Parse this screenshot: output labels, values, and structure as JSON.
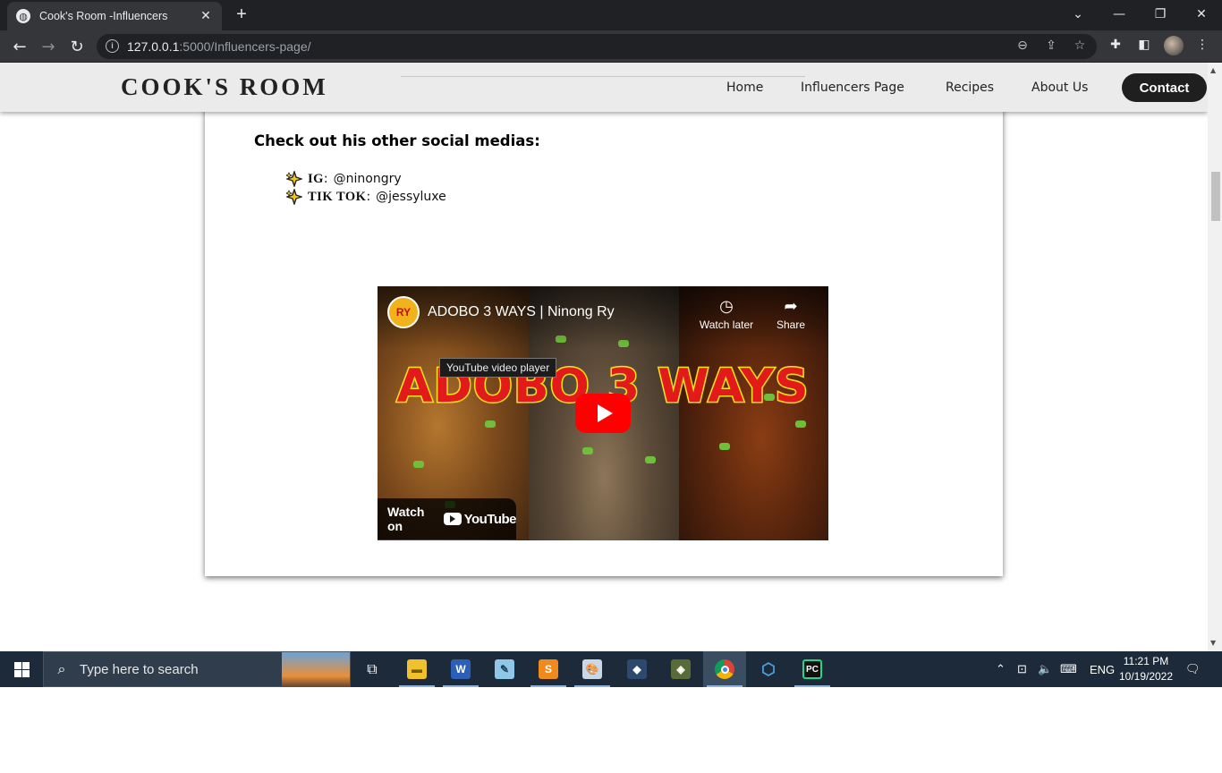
{
  "browser": {
    "tab_title": "Cook's Room -Influencers",
    "tab_favicon": "globe-icon",
    "new_tab_symbol": "+",
    "url_host": "127.0.0.1",
    "url_path": ":5000/Influencers-page/",
    "window_controls": [
      "chevron-down-icon",
      "minimize-icon",
      "restore-icon",
      "close-icon"
    ]
  },
  "site": {
    "brand": "COOK'S ROOM",
    "nav": [
      "Home",
      "Influencers Page",
      "Recipes",
      "About Us"
    ],
    "contact": "Contact"
  },
  "content": {
    "social_heading": "Check out his other social medias:",
    "socials": [
      {
        "key": "IG",
        "handle": "@ninongry"
      },
      {
        "key": "TIK TOK",
        "handle": "@jessyluxe"
      }
    ]
  },
  "video": {
    "channel_logo_text": "RY",
    "title": "ADOBO 3 WAYS | Ninong Ry",
    "watch_later": "Watch later",
    "share": "Share",
    "overlay_text": "ADOBO 3 WAYS",
    "tooltip": "YouTube video player",
    "watch_on": "Watch on",
    "youtube_logo": "YouTube"
  },
  "taskbar": {
    "search_placeholder": "Type here to search",
    "apps": [
      "task-view-icon",
      "file-explorer-icon",
      "word-icon",
      "notepad-icon",
      "sublime-text-icon",
      "paint-icon",
      "mysql-workbench-icon",
      "git-icon",
      "chrome-icon",
      "box-icon",
      "pycharm-icon"
    ],
    "language": "ENG",
    "time": "11:21 PM",
    "date": "10/19/2022"
  },
  "colors": {
    "brand_dark": "#1f1f1f",
    "header_bg": "#ebebeb",
    "youtube_red": "#ff0000",
    "taskbar_bg": "#1c2a3a"
  }
}
